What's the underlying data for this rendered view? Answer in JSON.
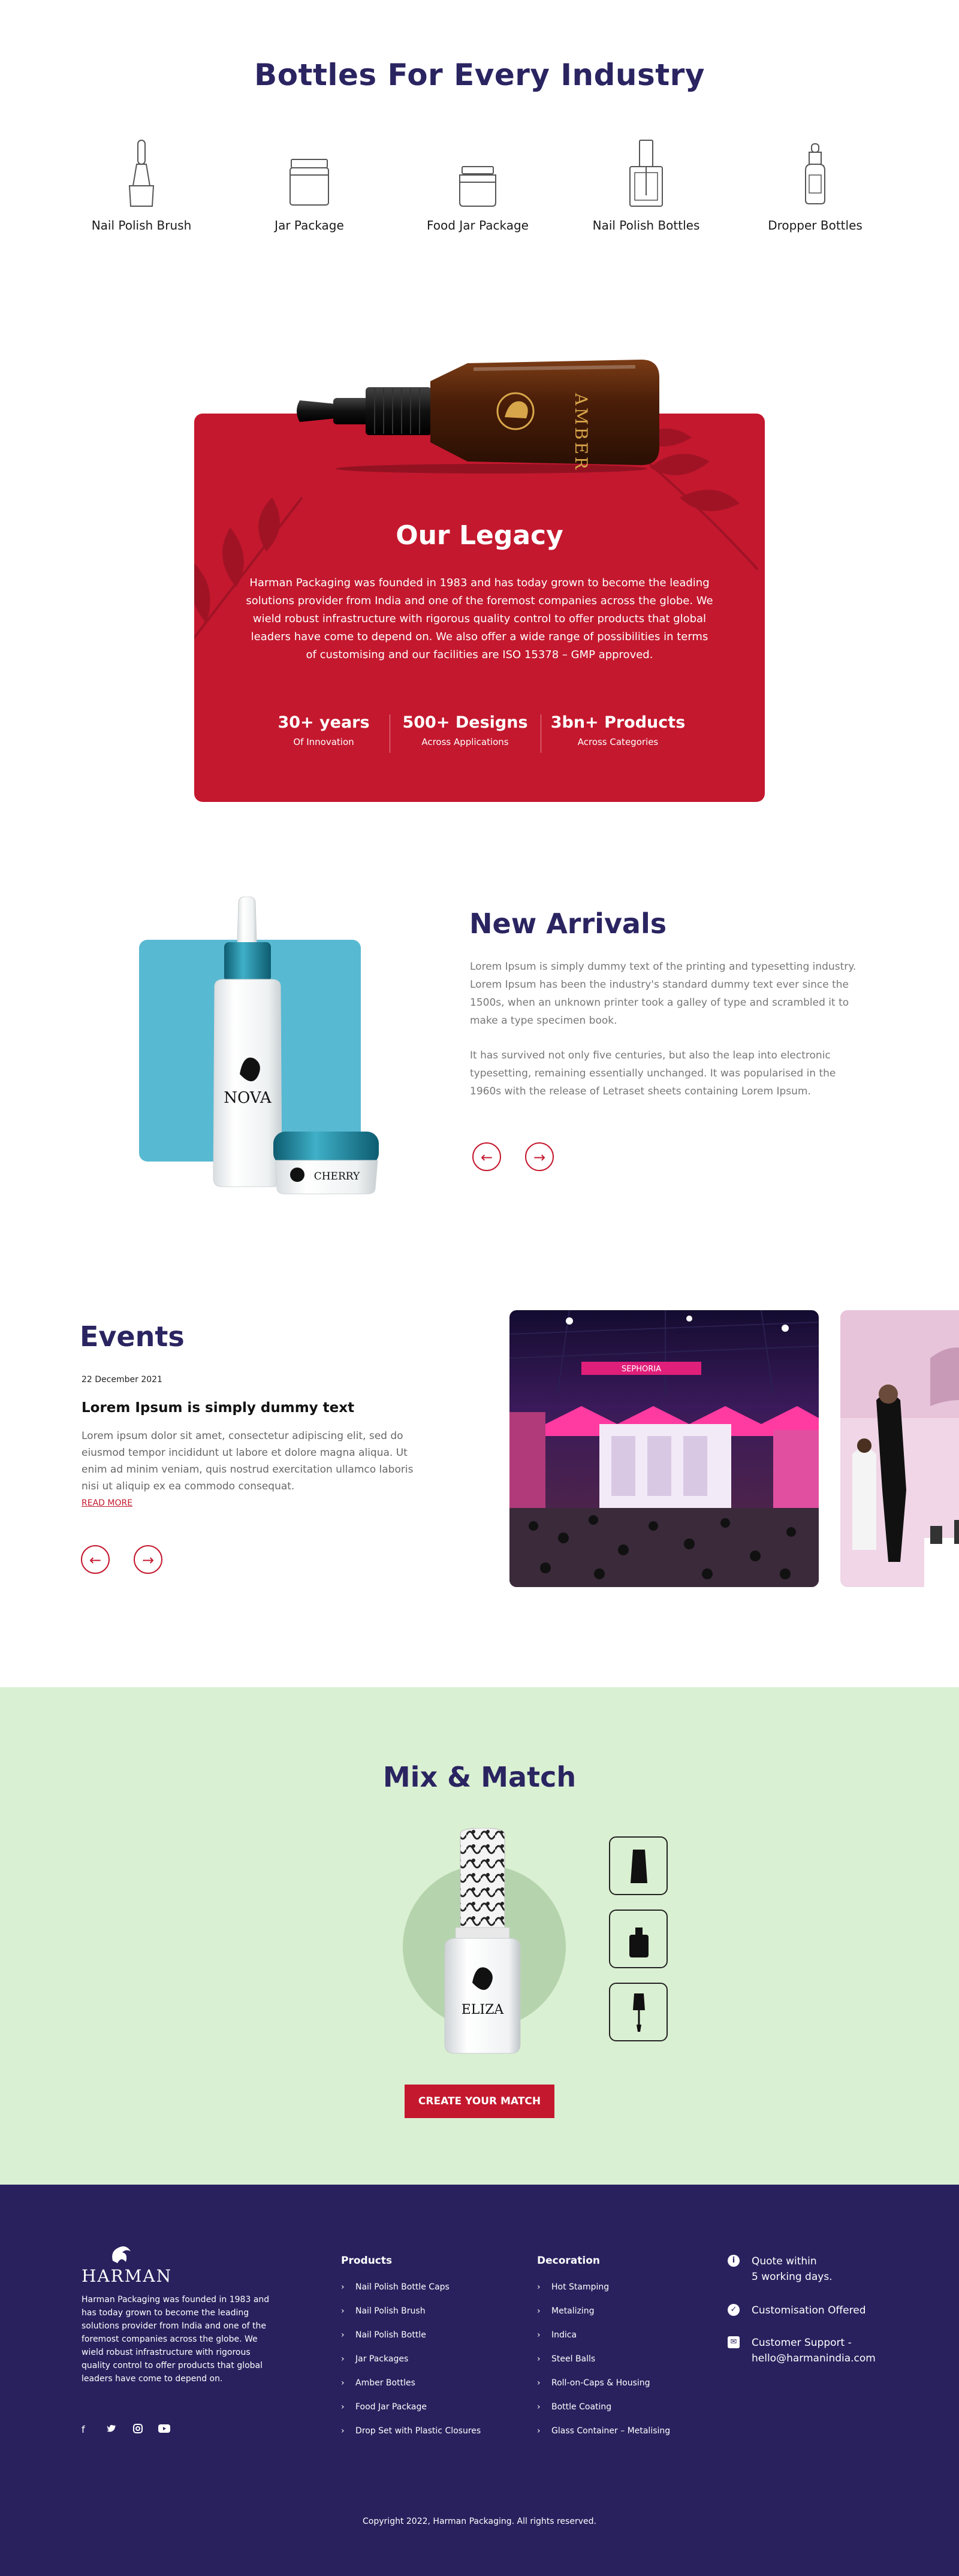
{
  "bottles": {
    "title": "Bottles For Every Industry",
    "items": [
      {
        "label": "Nail Polish Brush",
        "icon": "nail-polish-brush-icon"
      },
      {
        "label": "Jar Package",
        "icon": "jar-icon"
      },
      {
        "label": "Food Jar Package",
        "icon": "food-jar-icon"
      },
      {
        "label": "Nail Polish Bottles",
        "icon": "nail-polish-bottle-icon"
      },
      {
        "label": "Dropper Bottles",
        "icon": "dropper-bottle-icon"
      }
    ]
  },
  "legacy": {
    "product_label": "AMBER",
    "title": "Our Legacy",
    "text": "Harman Packaging was founded in 1983 and has today grown to become the leading solutions provider from India and one of the foremost companies across the globe. We wield robust infrastructure with rigorous quality control to offer products that global leaders have come to depend on. We also offer a wide range of possibilities in terms of customising and our facilities are ISO 15378 – GMP approved.",
    "stats": [
      {
        "value": "30+ years",
        "caption": "Of Innovation"
      },
      {
        "value": "500+ Designs",
        "caption": "Across Applications"
      },
      {
        "value": "3bn+ Products",
        "caption": "Across Categories"
      }
    ]
  },
  "new_arrivals": {
    "title": "New Arrivals",
    "product_labels": [
      "NOVA",
      "CHERRY"
    ],
    "para1": "Lorem Ipsum is simply dummy text of the printing and typesetting industry. Lorem Ipsum has been the industry's standard dummy text ever since the 1500s, when an unknown printer took a galley of type and scrambled it to make a type specimen book.",
    "para2": "It has survived not only five centuries, but also the leap into electronic typesetting, remaining essentially unchanged. It was popularised in the 1960s with the release of Letraset sheets containing Lorem Ipsum.",
    "prev": "←",
    "next": "→"
  },
  "events": {
    "title": "Events",
    "date": "22 December 2021",
    "headline": "Lorem Ipsum is simply dummy text",
    "body": "Lorem ipsum dolor sit amet, consectetur adipiscing elit, sed do eiusmod tempor incididunt ut labore et dolore magna aliqua. Ut enim ad minim veniam, quis nostrud exercitation ullamco laboris nisi ut aliquip ex ea commodo consequat.",
    "read_more": "READ MORE",
    "prev": "←",
    "next": "→",
    "photo_sign": "SEPHORIA"
  },
  "mix_match": {
    "title": "Mix & Match",
    "bottle_label": "ELIZA",
    "button": "CREATE YOUR MATCH",
    "options": [
      "cap-option-icon",
      "bottle-option-icon",
      "brush-option-icon"
    ]
  },
  "footer": {
    "brand": "HARMAN",
    "about": "Harman Packaging was founded in 1983 and has today grown to become the leading solutions provider from India and one of the foremost companies across the globe. We wield robust infrastructure with rigorous quality control to offer products that global leaders have come to depend on.",
    "social": [
      "f",
      "t",
      "ig",
      "yt"
    ],
    "products_title": "Products",
    "products": [
      "Nail Polish Bottle Caps",
      "Nail Polish Brush",
      "Nail Polish Bottle",
      "Jar Packages",
      "Amber Bottles",
      "Food Jar Package",
      "Drop Set with Plastic Closures"
    ],
    "decoration_title": "Decoration",
    "decoration": [
      "Hot Stamping",
      "Metalizing",
      "Indica",
      "Steel Balls",
      "Roll-on-Caps & Housing",
      "Bottle Coating",
      "Glass Container – Metalising"
    ],
    "contact": [
      {
        "line1": "Quote within",
        "line2": "5 working days."
      },
      {
        "line1": "Customisation Offered",
        "line2": ""
      },
      {
        "line1": "Customer Support -",
        "line2": "hello@harmanindia.com"
      }
    ],
    "copyright": "Copyright 2022, Harman Packaging. All rights reserved."
  },
  "colors": {
    "navy": "#2a2461",
    "red": "#c4182e",
    "teal": "#58b9d2",
    "mint": "#daf0d2",
    "footer": "#29215e"
  }
}
